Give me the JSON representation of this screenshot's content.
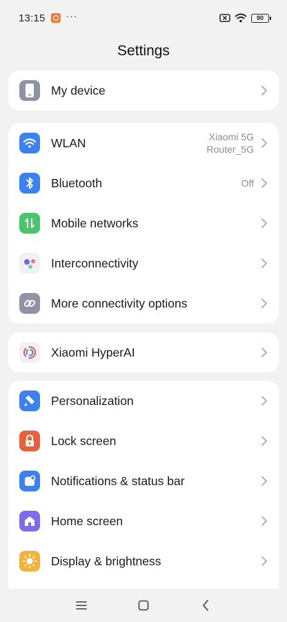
{
  "status_bar": {
    "time": "13:15",
    "overflow": "···",
    "battery": "90"
  },
  "header": {
    "title": "Settings"
  },
  "groups": [
    {
      "items": [
        {
          "label": "My device",
          "icon": "phone-icon",
          "color": "#8e93a6"
        }
      ]
    },
    {
      "items": [
        {
          "label": "WLAN",
          "value_line1": "Xiaomi 5G",
          "value_line2": "Router_5G",
          "icon": "wifi-icon",
          "color": "#3b82f0"
        },
        {
          "label": "Bluetooth",
          "value": "Off",
          "icon": "bluetooth-icon",
          "color": "#3b82f0"
        },
        {
          "label": "Mobile networks",
          "icon": "mobile-data-icon",
          "color": "#4cc46b"
        },
        {
          "label": "Interconnectivity",
          "icon": "interconnectivity-icon",
          "color": "#f1f1f4"
        },
        {
          "label": "More connectivity options",
          "icon": "link-icon",
          "color": "#8e93a6"
        }
      ]
    },
    {
      "items": [
        {
          "label": "Xiaomi HyperAI",
          "icon": "hyperai-icon",
          "color": "#f1f1f4"
        }
      ]
    },
    {
      "items": [
        {
          "label": "Personalization",
          "icon": "brush-icon",
          "color": "#3b82f0"
        },
        {
          "label": "Lock screen",
          "icon": "lock-icon",
          "color": "#e9603a"
        },
        {
          "label": "Notifications & status bar",
          "icon": "notification-icon",
          "color": "#3b82f0"
        },
        {
          "label": "Home screen",
          "icon": "home-icon",
          "color": "#7b6cf0"
        },
        {
          "label": "Display & brightness",
          "icon": "sun-icon",
          "color": "#f2b23c"
        }
      ]
    }
  ],
  "nav_bar": {
    "items": [
      "menu-icon",
      "home-button-icon",
      "back-icon"
    ]
  }
}
